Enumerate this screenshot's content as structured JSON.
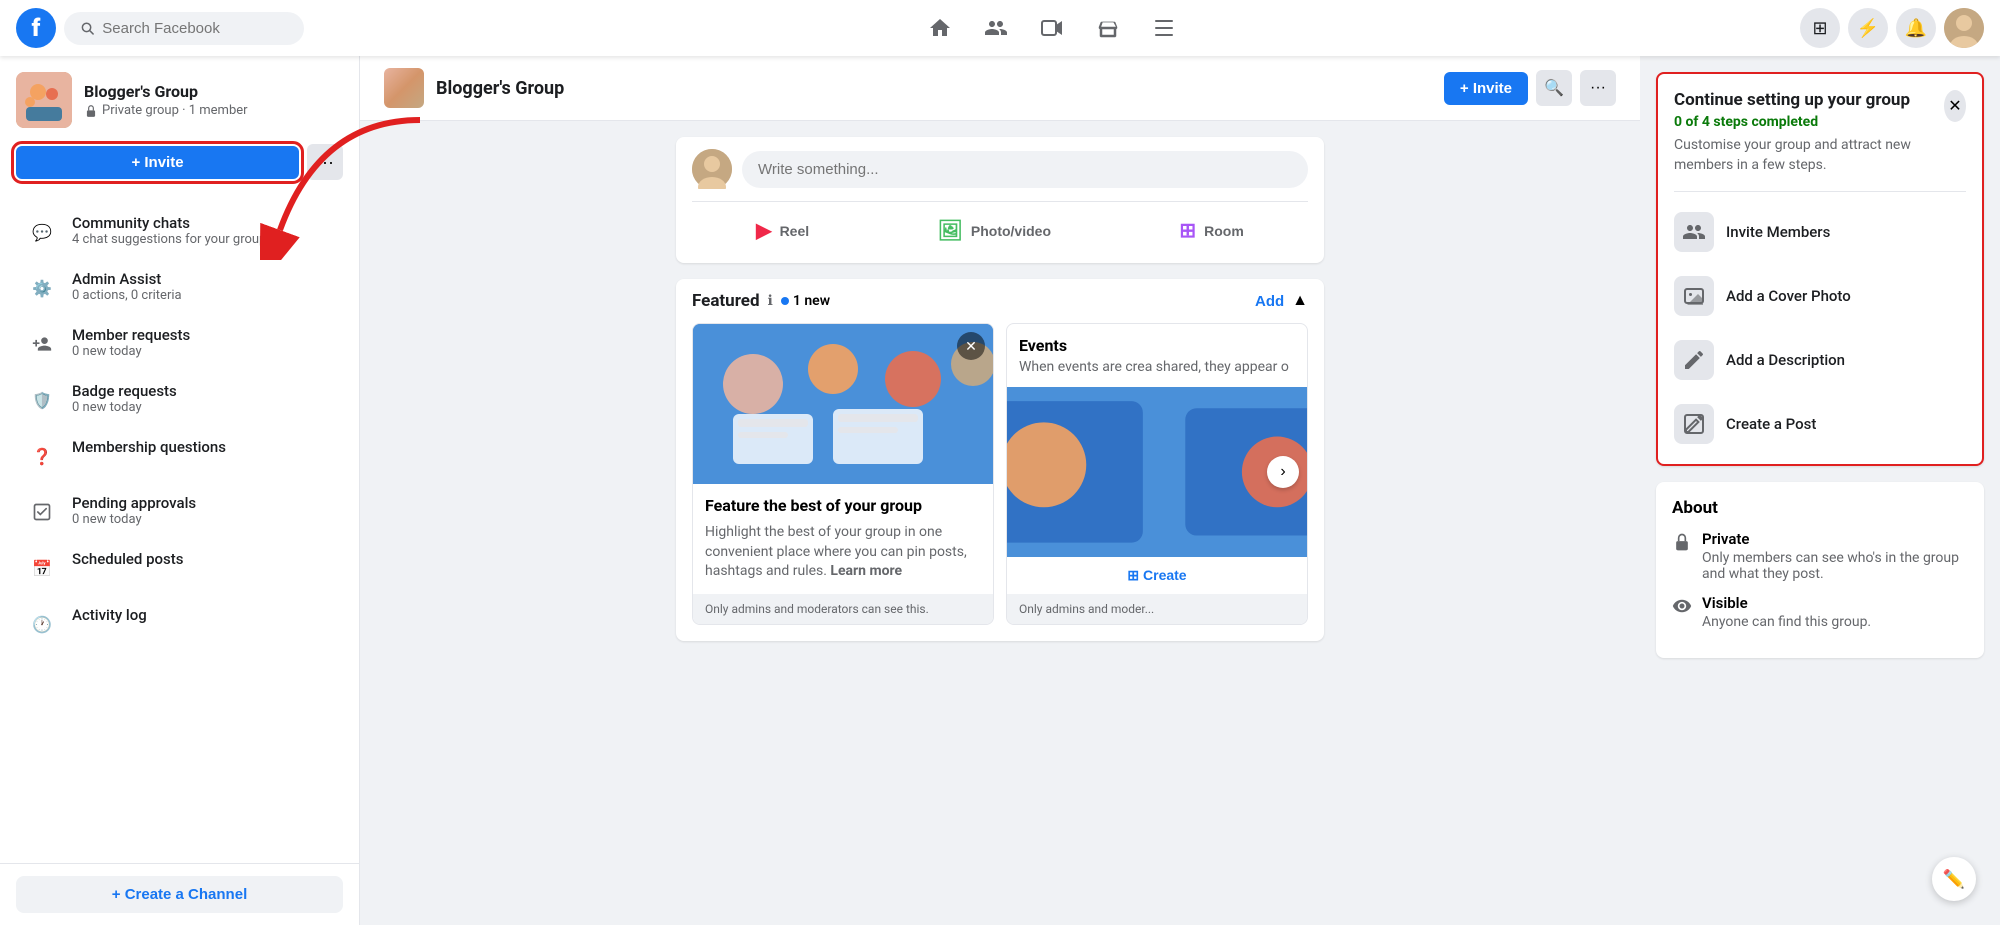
{
  "topbar": {
    "logo": "f",
    "search_placeholder": "Search Facebook",
    "nav_icons": [
      "home",
      "friends",
      "video",
      "marketplace",
      "menu"
    ]
  },
  "sidebar": {
    "group_name": "Blogger's Group",
    "group_meta": "Private group · 1 member",
    "invite_label": "+ Invite",
    "more_label": "···",
    "nav_items": [
      {
        "icon": "💬",
        "title": "Community chats",
        "sub": "4 chat suggestions for your group"
      },
      {
        "icon": "⚙️",
        "title": "Admin Assist",
        "sub": "0 actions, 0 criteria"
      },
      {
        "icon": "👤",
        "title": "Member requests",
        "sub": "0 new today"
      },
      {
        "icon": "🛡️",
        "title": "Badge requests",
        "sub": "0 new today"
      },
      {
        "icon": "❓",
        "title": "Membership questions",
        "sub": ""
      },
      {
        "icon": "✅",
        "title": "Pending approvals",
        "sub": "0 new today"
      },
      {
        "icon": "📅",
        "title": "Scheduled posts",
        "sub": ""
      },
      {
        "icon": "🕐",
        "title": "Activity log",
        "sub": ""
      }
    ],
    "create_channel": "+ Create a Channel"
  },
  "group_header": {
    "name": "Blogger's Group",
    "invite_label": "+ Invite",
    "search_title": "Search",
    "more_title": "More"
  },
  "post_box": {
    "placeholder": "Write something...",
    "actions": [
      "Reel",
      "Photo/video",
      "Room"
    ]
  },
  "featured": {
    "title": "Featured",
    "new_count": "1 new",
    "info": "ℹ",
    "add_label": "Add",
    "card1": {
      "title": "Feature the best of your group",
      "desc": "Highlight the best of your group in one convenient place where you can pin posts, hashtags and rules.",
      "learn_more": "Learn more",
      "footer": "Only admins and moderators can see this."
    },
    "card2": {
      "title": "Events",
      "desc": "When events are crea shared, they appear o",
      "create_label": "⊞ Create",
      "footer": "Only admins and moder..."
    }
  },
  "setup_card": {
    "title": "Continue setting up your group",
    "progress": "0 of 4 steps completed",
    "desc": "Customise your group and attract new members in a few steps.",
    "steps": [
      {
        "icon": "👥",
        "label": "Invite Members"
      },
      {
        "icon": "🖼️",
        "label": "Add a Cover Photo"
      },
      {
        "icon": "✏️",
        "label": "Add a Description"
      },
      {
        "icon": "📝",
        "label": "Create a Post"
      }
    ]
  },
  "about": {
    "title": "About",
    "items": [
      {
        "icon": "🔒",
        "title": "Private",
        "desc": "Only members can see who's in the group and what they post."
      },
      {
        "icon": "👁️",
        "title": "Visible",
        "desc": "Anyone can find this group."
      }
    ]
  }
}
